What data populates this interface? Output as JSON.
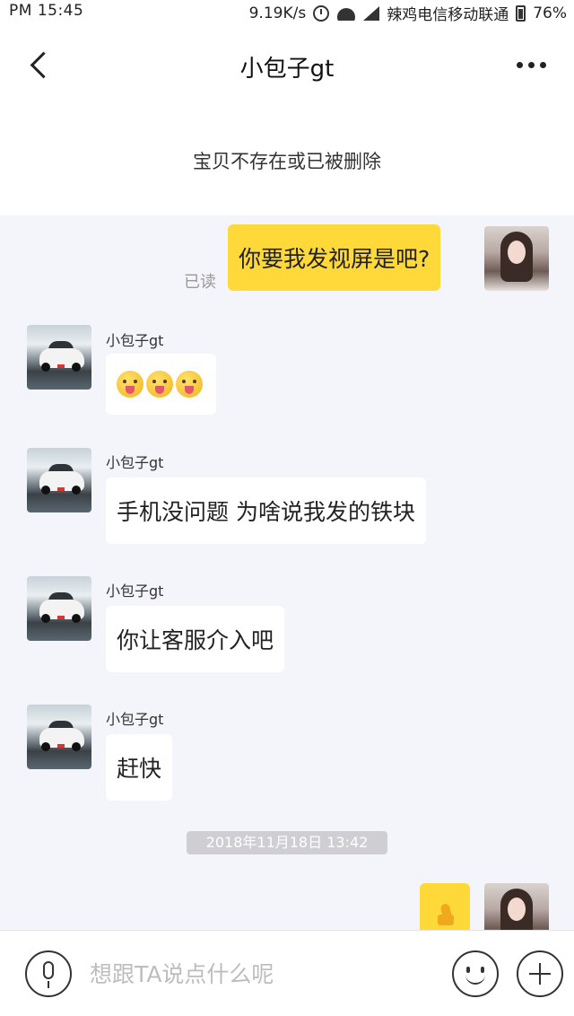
{
  "status_bar": {
    "time": "PM 15:45",
    "net_speed": "9.19K/s",
    "carrier": "辣鸡电信移动联通",
    "battery": "76%"
  },
  "header": {
    "title": "小包子gt"
  },
  "item_banner": {
    "text": "宝贝不存在或已被删除"
  },
  "messages": [
    {
      "side": "mine",
      "text": "你要我发视屏是吧?",
      "read_label": "已读"
    },
    {
      "side": "other",
      "sender": "小包子gt",
      "content": "emoji",
      "emoji": [
        "tongue-face-emoji",
        "tongue-face-emoji",
        "tongue-face-emoji"
      ]
    },
    {
      "side": "other",
      "sender": "小包子gt",
      "text": "手机没问题 为啥说我发的铁块"
    },
    {
      "side": "other",
      "sender": "小包子gt",
      "text": "你让客服介入吧"
    },
    {
      "side": "other",
      "sender": "小包子gt",
      "text": "赶快"
    },
    {
      "side": "mine",
      "content": "thumbs-up-icon"
    }
  ],
  "timestamp": "2018年11月18日 13:42",
  "input_bar": {
    "placeholder": "想跟TA说点什么呢"
  },
  "colors": {
    "my_bubble": "#ffd939",
    "chat_bg": "#f4f5fb"
  }
}
